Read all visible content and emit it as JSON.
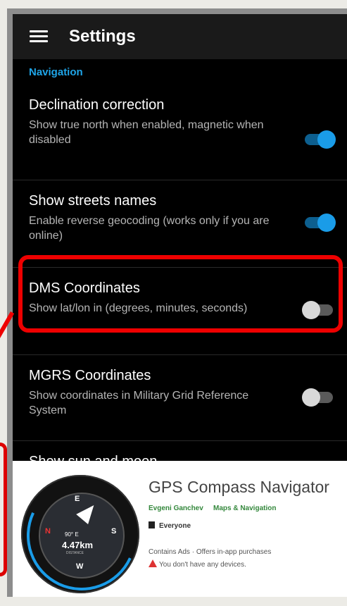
{
  "appbar": {
    "title": "Settings",
    "menu_icon": "hamburger-menu-icon"
  },
  "section": {
    "label": "Navigation"
  },
  "settings": [
    {
      "title": "Declination correction",
      "subtitle": "Show true north when enabled, magnetic when disabled",
      "enabled": true
    },
    {
      "title": "Show streets names",
      "subtitle": "Enable reverse geocoding (works only if you are online)",
      "enabled": true
    },
    {
      "title": "DMS Coordinates",
      "subtitle": "Show lat/lon in (degrees, minutes, seconds)",
      "enabled": false
    },
    {
      "title": "MGRS Coordinates",
      "subtitle": "Show coordinates in Military Grid Reference System",
      "enabled": false
    },
    {
      "title": "Show sun and moon",
      "subtitle": "",
      "enabled": true
    }
  ],
  "store": {
    "app_title": "GPS Compass Navigator",
    "developer": "Evgeni Ganchev",
    "category": "Maps & Navigation",
    "rating": "Everyone",
    "ads": "Contains Ads · Offers in-app purchases",
    "warning": "You don't have any devices.",
    "icon": {
      "degree": "90° E",
      "distance": "4.47km",
      "distance_label": "DISTANCE",
      "north": "N",
      "east": "E",
      "south": "S",
      "west": "W"
    }
  },
  "colors": {
    "accent": "#1a9ce8",
    "highlight": "#ee0000",
    "section": "#1fa5e8"
  }
}
